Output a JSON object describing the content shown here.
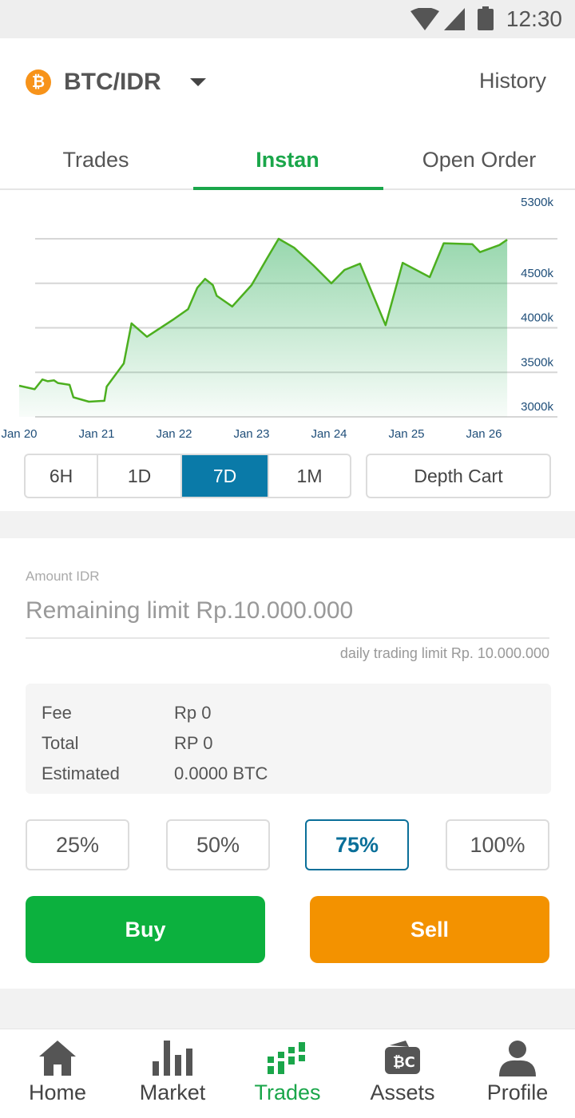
{
  "status_bar": {
    "time": "12:30"
  },
  "header": {
    "pair": "BTC/IDR",
    "btc_symbol": "₿",
    "history_label": "History"
  },
  "tabs": [
    {
      "label": "Trades",
      "active": false
    },
    {
      "label": "Instan",
      "active": true
    },
    {
      "label": "Open Order",
      "active": false
    }
  ],
  "chart_data": {
    "type": "area",
    "title": "",
    "x": [
      "Jan 20",
      "Jan 21",
      "Jan 22",
      "Jan 23",
      "Jan 24",
      "Jan 25",
      "Jan 26"
    ],
    "y_ticks": [
      "5300k",
      "4500k",
      "4000k",
      "3500k",
      "3000k"
    ],
    "y_tick_values": [
      5000,
      4500,
      4000,
      3500,
      3000
    ],
    "ylim": [
      3000,
      5350
    ],
    "line_color": "#4caf1f",
    "fill_color": "#1aa64a",
    "series": [
      {
        "points": [
          [
            0.0,
            3350
          ],
          [
            0.2,
            3310
          ],
          [
            0.3,
            3420
          ],
          [
            0.37,
            3400
          ],
          [
            0.45,
            3410
          ],
          [
            0.5,
            3380
          ],
          [
            0.65,
            3360
          ],
          [
            0.7,
            3220
          ],
          [
            0.9,
            3170
          ],
          [
            1.1,
            3180
          ],
          [
            1.13,
            3340
          ],
          [
            1.35,
            3600
          ],
          [
            1.45,
            4050
          ],
          [
            1.65,
            3900
          ],
          [
            2.0,
            4100
          ],
          [
            2.18,
            4210
          ],
          [
            2.3,
            4450
          ],
          [
            2.4,
            4550
          ],
          [
            2.5,
            4480
          ],
          [
            2.55,
            4360
          ],
          [
            2.75,
            4240
          ],
          [
            3.0,
            4480
          ],
          [
            3.2,
            4780
          ],
          [
            3.35,
            5000
          ],
          [
            3.55,
            4900
          ],
          [
            3.8,
            4700
          ],
          [
            4.03,
            4500
          ],
          [
            4.2,
            4650
          ],
          [
            4.4,
            4720
          ],
          [
            4.73,
            4030
          ],
          [
            4.95,
            4730
          ],
          [
            5.3,
            4570
          ],
          [
            5.48,
            4950
          ],
          [
            5.85,
            4940
          ],
          [
            5.95,
            4850
          ],
          [
            6.2,
            4930
          ],
          [
            6.3,
            4990
          ]
        ]
      }
    ]
  },
  "ranges": [
    {
      "label": "6H",
      "active": false
    },
    {
      "label": "1D",
      "active": false
    },
    {
      "label": "7D",
      "active": true
    },
    {
      "label": "1M",
      "active": false
    }
  ],
  "depth_label": "Depth Cart",
  "form": {
    "amount_label": "Amount IDR",
    "amount_placeholder": "Remaining limit Rp.10.000.000",
    "limit_note": "daily trading limit Rp. 10.000.000",
    "summary": [
      {
        "key": "Fee",
        "value": "Rp 0"
      },
      {
        "key": "Total",
        "value": "RP 0"
      },
      {
        "key": "Estimated",
        "value": "0.0000 BTC"
      }
    ],
    "percents": [
      {
        "label": "25%",
        "active": false
      },
      {
        "label": "50%",
        "active": false
      },
      {
        "label": "75%",
        "active": true
      },
      {
        "label": "100%",
        "active": false
      }
    ],
    "buy_label": "Buy",
    "sell_label": "Sell",
    "buy_color": "#0cb13e",
    "sell_color": "#f39200"
  },
  "nav": [
    {
      "label": "Home",
      "icon": "home-icon",
      "active": false
    },
    {
      "label": "Market",
      "icon": "market-icon",
      "active": false
    },
    {
      "label": "Trades",
      "icon": "trades-icon",
      "active": true
    },
    {
      "label": "Assets",
      "icon": "assets-icon",
      "active": false
    },
    {
      "label": "Profile",
      "icon": "profile-icon",
      "active": false
    }
  ]
}
